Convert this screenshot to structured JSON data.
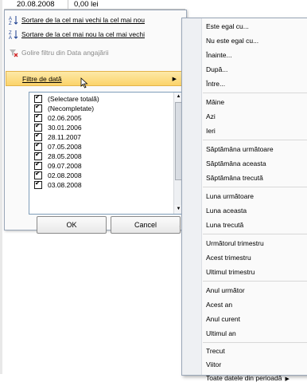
{
  "sheet": {
    "date_cell": "20.08.2008",
    "value_cell": "0,00 lei"
  },
  "filter_menu": {
    "sort_oldest": "Sortare de la cel mai vechi la cel mai nou",
    "sort_newest": "Sortare de la cel mai nou la cel mai vechi",
    "clear_filter": "Golire filtru din Data angajării",
    "date_filters": "Filtre de dată"
  },
  "list": [
    "(Selectare totală)",
    "(Necompletate)",
    "02.06.2005",
    "30.01.2006",
    "28.11.2007",
    "07.05.2008",
    "28.05.2008",
    "09.07.2008",
    "02.08.2008",
    "03.08.2008"
  ],
  "buttons": {
    "ok": "OK",
    "cancel": "Cancel"
  },
  "submenu": [
    "Este egal cu...",
    "Nu este egal cu...",
    "Înainte...",
    "După...",
    "Între...",
    "Mâine",
    "Azi",
    "Ieri",
    "Săptămâna următoare",
    "Săptămâna aceasta",
    "Săptămâna trecută",
    "Luna următoare",
    "Luna aceasta",
    "Luna trecută",
    "Următorul trimestru",
    "Acest trimestru",
    "Ultimul trimestru",
    "Anul următor",
    "Acest an",
    "Anul curent",
    "Ultimul an",
    "Trecut",
    "Viitor",
    "Toate datele din perioadă"
  ],
  "colors": {
    "hover_bg": "#fbd36a",
    "border": "#9aa7b8"
  },
  "icons": [
    "sort-ascending-icon",
    "sort-descending-icon",
    "clear-filter-icon",
    "submenu-arrow-icon",
    "checkbox-icon"
  ]
}
